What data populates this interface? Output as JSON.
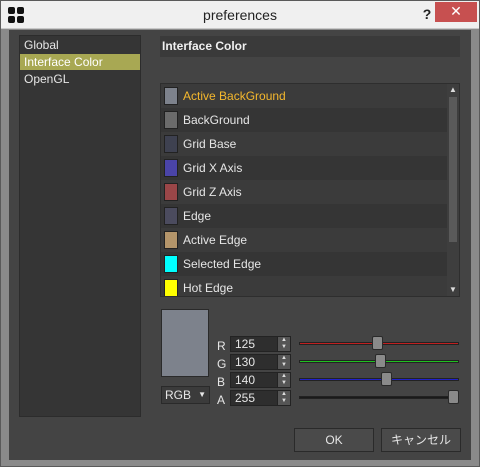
{
  "window": {
    "title": "preferences",
    "help_label": "?",
    "close_label": "✕"
  },
  "sidebar": {
    "items": [
      {
        "label": "Global",
        "selected": false
      },
      {
        "label": "Interface Color",
        "selected": true
      },
      {
        "label": "OpenGL",
        "selected": false
      }
    ]
  },
  "panel": {
    "title": "Interface Color"
  },
  "colors": [
    {
      "label": "Active BackGround",
      "swatch": "#7d828c",
      "active": true
    },
    {
      "label": "BackGround",
      "swatch": "#6b6b6b",
      "active": false
    },
    {
      "label": "Grid Base",
      "swatch": "#3e4150",
      "active": false
    },
    {
      "label": "Grid X Axis",
      "swatch": "#4a44a8",
      "active": false
    },
    {
      "label": "Grid Z Axis",
      "swatch": "#9a4648",
      "active": false
    },
    {
      "label": "Edge",
      "swatch": "#4b4b5e",
      "active": false
    },
    {
      "label": "Active Edge",
      "swatch": "#b4956a",
      "active": false
    },
    {
      "label": "Selected Edge",
      "swatch": "#00ffff",
      "active": false
    },
    {
      "label": "Hot Edge",
      "swatch": "#ffff00",
      "active": false
    }
  ],
  "editor": {
    "preview_color": "#7d828c",
    "mode": "RGB",
    "channels": [
      {
        "label": "R",
        "value": "125",
        "fraction": 0.49,
        "track_color": "#c02020"
      },
      {
        "label": "G",
        "value": "130",
        "fraction": 0.51,
        "track_color": "#20c020"
      },
      {
        "label": "B",
        "value": "140",
        "fraction": 0.55,
        "track_color": "#2020c8"
      },
      {
        "label": "A",
        "value": "255",
        "fraction": 1.0,
        "track_color": "#1a1a1a"
      }
    ]
  },
  "buttons": {
    "ok": "OK",
    "cancel": "キャンセル"
  }
}
